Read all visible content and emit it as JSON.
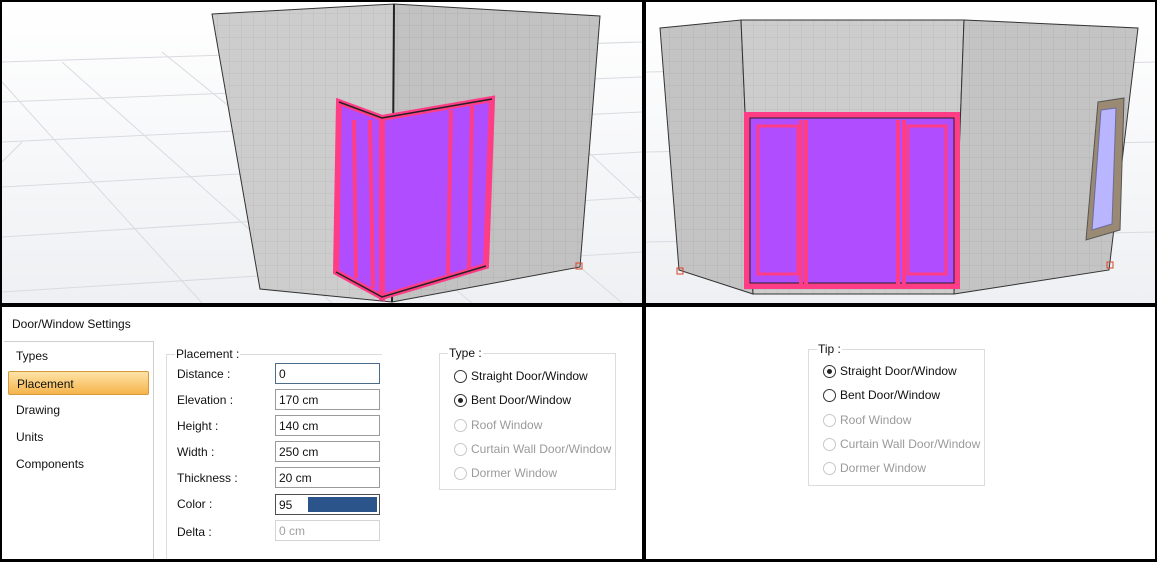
{
  "dialog": {
    "title": "Door/Window Settings"
  },
  "nav": {
    "items": [
      {
        "label": "Types",
        "active": false
      },
      {
        "label": "Placement",
        "active": true
      },
      {
        "label": "Drawing",
        "active": false
      },
      {
        "label": "Units",
        "active": false
      },
      {
        "label": "Components",
        "active": false
      }
    ]
  },
  "placement": {
    "title": "Placement :",
    "distance": {
      "label": "Distance :",
      "value": "0"
    },
    "elevation": {
      "label": "Elevation :",
      "value": "170 cm"
    },
    "height": {
      "label": "Height :",
      "value": "140 cm"
    },
    "width": {
      "label": "Width :",
      "value": "250 cm"
    },
    "thickness": {
      "label": "Thickness :",
      "value": "20 cm"
    },
    "color": {
      "label": "Color :",
      "value": "95",
      "swatch": "#2b548a"
    },
    "delta": {
      "label": "Delta :",
      "value": "0 cm"
    }
  },
  "type_group": {
    "title": "Type :",
    "options": [
      {
        "label": "Straight Door/Window",
        "checked": false,
        "enabled": true
      },
      {
        "label": "Bent Door/Window",
        "checked": true,
        "enabled": true
      },
      {
        "label": "Roof Window",
        "checked": false,
        "enabled": false
      },
      {
        "label": "Curtain Wall Door/Window",
        "checked": false,
        "enabled": false
      },
      {
        "label": "Dormer Window",
        "checked": false,
        "enabled": false
      }
    ]
  },
  "tip_group": {
    "title": "Tip :",
    "options": [
      {
        "label": "Straight Door/Window",
        "checked": true,
        "enabled": true
      },
      {
        "label": "Bent Door/Window",
        "checked": false,
        "enabled": true
      },
      {
        "label": "Roof Window",
        "checked": false,
        "enabled": false
      },
      {
        "label": "Curtain Wall Door/Window",
        "checked": false,
        "enabled": false
      },
      {
        "label": "Dormer Window",
        "checked": false,
        "enabled": false
      }
    ]
  },
  "colors": {
    "window_fill": "#b04dff",
    "window_frame": "#ff3d86",
    "wall": "#cfcfcf",
    "accent": "#f6b44c"
  }
}
